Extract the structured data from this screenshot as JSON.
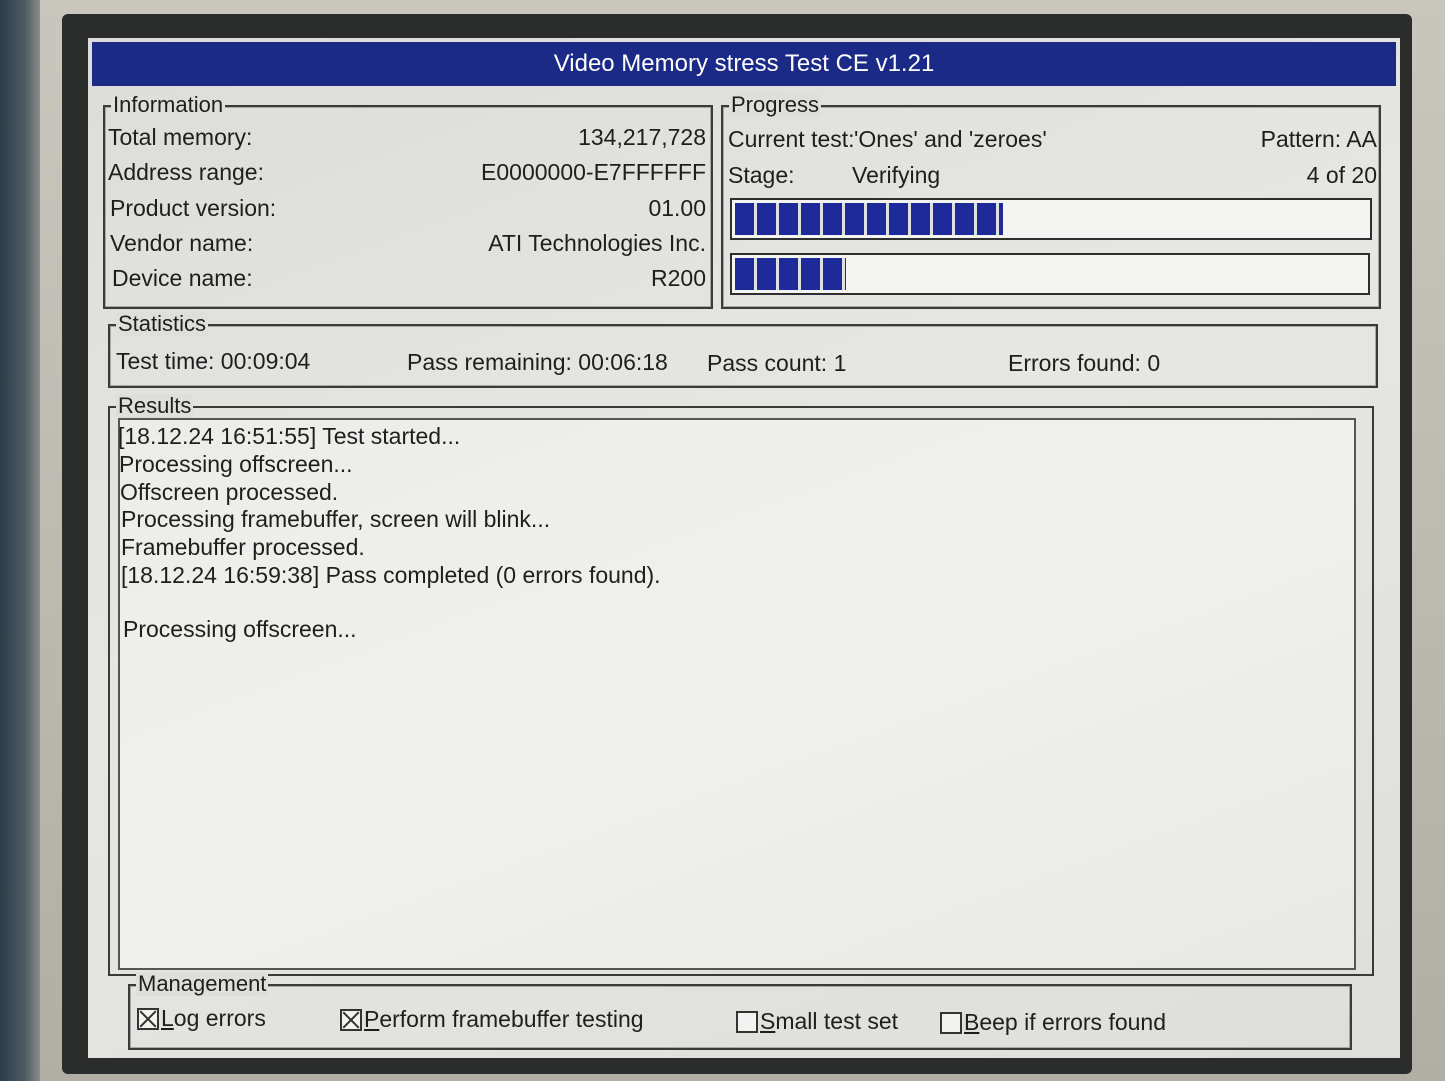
{
  "window": {
    "title": "Video Memory stress Test CE v1.21"
  },
  "information": {
    "label": "Information",
    "rows": [
      {
        "label": "Total memory:",
        "value": "134,217,728"
      },
      {
        "label": "Address range:",
        "value": "E0000000-E7FFFFFF"
      },
      {
        "label": "Product version:",
        "value": "01.00"
      },
      {
        "label": "Vendor name:",
        "value": "ATI Technologies Inc."
      },
      {
        "label": "Device name:",
        "value": "R200"
      }
    ]
  },
  "progress": {
    "label": "Progress",
    "current_test_label": "Current test:",
    "current_test_value": "'Ones' and 'zeroes'",
    "pattern": "Pattern: AA",
    "stage_label": "Stage:",
    "stage_value": "Verifying",
    "step": "4 of 20",
    "bar1_fraction": 0.42,
    "bar2_fraction": 0.175,
    "bar_color": "#1f2a9a"
  },
  "statistics": {
    "label": "Statistics",
    "test_time": "Test time:  00:09:04",
    "pass_remaining": "Pass remaining:  00:06:18",
    "pass_count": "Pass count:  1",
    "errors_found": "Errors found:  0"
  },
  "results": {
    "label": "Results",
    "lines": [
      "[18.12.24 16:51:55] Test started...",
      "Processing offscreen...",
      "Offscreen processed.",
      "Processing framebuffer, screen will blink...",
      "Framebuffer processed.",
      "[18.12.24 16:59:38] Pass completed (0 errors found).",
      "",
      "Processing offscreen..."
    ]
  },
  "management": {
    "label": "Management",
    "options": [
      {
        "first": "L",
        "rest": "og errors",
        "checked": true
      },
      {
        "first": "P",
        "rest": "erform framebuffer testing",
        "checked": true
      },
      {
        "first": "S",
        "rest": "mall test set",
        "checked": false
      },
      {
        "first": "B",
        "rest": "eep if errors found",
        "checked": false
      }
    ]
  },
  "colors": {
    "title_bar": "#1a2a86",
    "title_text": "#ffffff"
  }
}
